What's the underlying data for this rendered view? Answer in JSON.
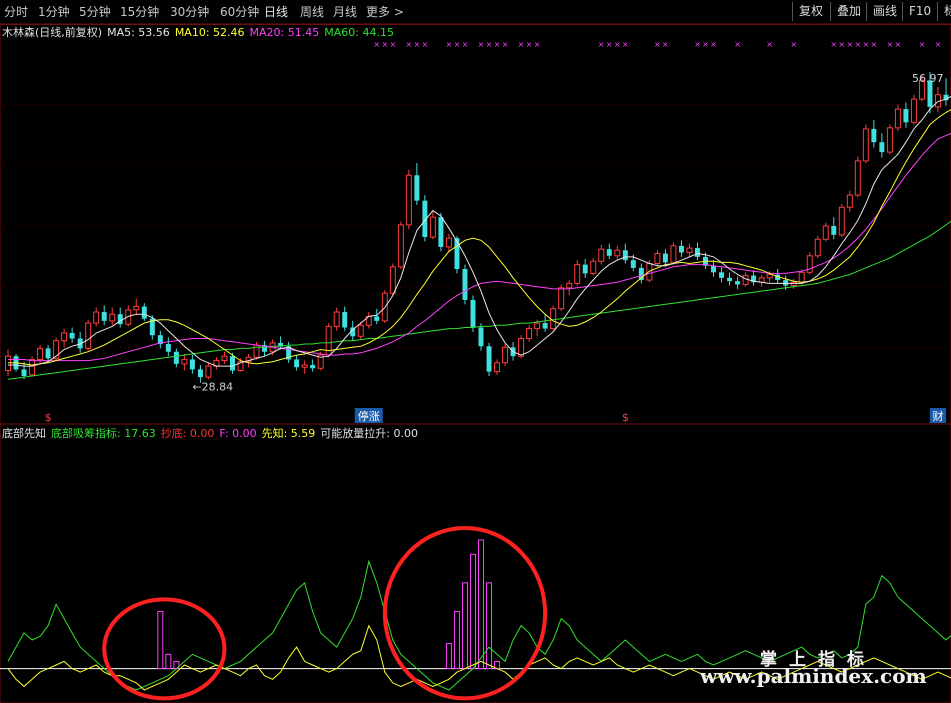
{
  "toolbar": {
    "periods": [
      "分时",
      "1分钟",
      "5分钟",
      "15分钟",
      "30分钟",
      "60分钟",
      "日线",
      "周线",
      "月线",
      "更多 >"
    ],
    "active_period": "日线",
    "buttons": [
      "复权",
      "叠加",
      "画线",
      "F10",
      "标"
    ]
  },
  "main_legend": {
    "name": "木林森(日线,前复权)",
    "ma5": "MA5: 53.56",
    "ma10": "MA10: 52.46",
    "ma20": "MA20: 51.45",
    "ma60": "MA60: 44.15"
  },
  "indicator_legend": {
    "name": "底部先知",
    "d1": "底部吸筹指标: 17.63",
    "d2": "抄底: 0.00",
    "d3": "F: 0.00",
    "d4": "先知: 5.59",
    "d5": "可能放量拉升: 0.00"
  },
  "colors": {
    "up": "#ff3c3c",
    "down": "#40e0e0",
    "ma5": "#e8e8e8",
    "ma10": "#ffff30",
    "ma20": "#ff40ff",
    "ma60": "#30e030",
    "bars": "#ff40ff",
    "ind_yellow": "#ffff30",
    "ind_green": "#30e030",
    "circle": "#ff2020"
  },
  "chart_data": {
    "type": "candlestick",
    "y_range": [
      26.5,
      59.5
    ],
    "price_max_label": "56.97",
    "price_min_label": "28.84",
    "candles": [
      [
        29.9,
        31.8,
        29.4,
        31.2
      ],
      [
        31.2,
        31.4,
        29.8,
        30.0
      ],
      [
        30.0,
        30.7,
        29.1,
        29.4
      ],
      [
        29.5,
        31.2,
        29.4,
        30.9
      ],
      [
        30.9,
        32.2,
        30.5,
        31.9
      ],
      [
        31.9,
        32.2,
        30.6,
        31.0
      ],
      [
        31.0,
        32.9,
        30.8,
        32.6
      ],
      [
        32.6,
        33.7,
        32.0,
        33.3
      ],
      [
        33.3,
        33.8,
        32.4,
        32.8
      ],
      [
        32.8,
        33.4,
        31.5,
        31.9
      ],
      [
        31.9,
        34.5,
        31.7,
        34.2
      ],
      [
        34.2,
        35.6,
        33.9,
        35.2
      ],
      [
        35.2,
        35.8,
        34.0,
        34.4
      ],
      [
        34.4,
        35.6,
        34.0,
        35.0
      ],
      [
        35.0,
        35.6,
        33.8,
        34.1
      ],
      [
        34.1,
        35.8,
        33.9,
        35.4
      ],
      [
        35.4,
        36.4,
        34.9,
        35.7
      ],
      [
        35.7,
        36.0,
        34.4,
        34.6
      ],
      [
        34.6,
        34.9,
        32.7,
        33.1
      ],
      [
        33.1,
        33.5,
        31.9,
        32.3
      ],
      [
        32.3,
        32.9,
        31.2,
        31.6
      ],
      [
        31.6,
        31.9,
        30.2,
        30.5
      ],
      [
        30.5,
        31.4,
        29.9,
        30.9
      ],
      [
        30.9,
        31.3,
        29.6,
        30.0
      ],
      [
        30.0,
        30.4,
        28.8,
        29.3
      ],
      [
        29.3,
        30.6,
        29.1,
        30.3
      ],
      [
        30.3,
        31.1,
        30.0,
        30.8
      ],
      [
        30.8,
        31.6,
        30.5,
        31.2
      ],
      [
        31.2,
        31.5,
        29.6,
        29.9
      ],
      [
        29.9,
        31.0,
        29.8,
        30.7
      ],
      [
        30.7,
        31.4,
        30.2,
        31.1
      ],
      [
        31.1,
        32.5,
        30.9,
        32.2
      ],
      [
        32.2,
        32.6,
        31.2,
        31.6
      ],
      [
        31.6,
        32.7,
        31.3,
        32.4
      ],
      [
        32.4,
        33.0,
        31.8,
        32.1
      ],
      [
        32.1,
        32.5,
        30.6,
        30.9
      ],
      [
        30.9,
        31.3,
        29.9,
        30.2
      ],
      [
        30.2,
        30.8,
        29.6,
        30.4
      ],
      [
        30.4,
        30.9,
        29.8,
        30.1
      ],
      [
        30.1,
        31.6,
        29.9,
        31.3
      ],
      [
        31.3,
        34.2,
        31.1,
        33.9
      ],
      [
        33.9,
        35.6,
        33.5,
        35.2
      ],
      [
        35.2,
        35.7,
        33.5,
        33.8
      ],
      [
        33.8,
        34.4,
        32.6,
        33.0
      ],
      [
        33.0,
        34.3,
        32.7,
        34.0
      ],
      [
        34.0,
        35.2,
        33.7,
        34.8
      ],
      [
        34.8,
        35.5,
        34.1,
        34.4
      ],
      [
        34.4,
        37.2,
        34.2,
        36.9
      ],
      [
        36.9,
        39.6,
        36.7,
        39.3
      ],
      [
        39.3,
        43.4,
        39.1,
        43.1
      ],
      [
        43.1,
        48.1,
        42.7,
        47.6
      ],
      [
        47.6,
        48.7,
        44.9,
        45.3
      ],
      [
        45.3,
        45.8,
        41.6,
        42.0
      ],
      [
        42.0,
        44.3,
        41.8,
        43.8
      ],
      [
        43.8,
        44.2,
        40.7,
        41.1
      ],
      [
        41.1,
        42.3,
        40.6,
        41.9
      ],
      [
        41.9,
        42.1,
        38.7,
        39.1
      ],
      [
        39.1,
        39.5,
        35.9,
        36.3
      ],
      [
        36.3,
        36.7,
        33.4,
        33.8
      ],
      [
        33.8,
        34.2,
        31.7,
        32.1
      ],
      [
        32.1,
        32.4,
        29.4,
        29.8
      ],
      [
        29.8,
        30.9,
        29.5,
        30.6
      ],
      [
        30.6,
        32.3,
        30.3,
        32.0
      ],
      [
        32.0,
        32.5,
        30.8,
        31.2
      ],
      [
        31.2,
        33.1,
        31.0,
        32.8
      ],
      [
        32.8,
        34.0,
        32.5,
        33.7
      ],
      [
        33.7,
        34.5,
        33.0,
        34.2
      ],
      [
        34.2,
        35.0,
        33.4,
        33.7
      ],
      [
        33.7,
        35.8,
        33.5,
        35.5
      ],
      [
        35.5,
        37.7,
        35.3,
        37.4
      ],
      [
        37.4,
        38.1,
        36.7,
        37.8
      ],
      [
        37.8,
        39.9,
        37.6,
        39.5
      ],
      [
        39.5,
        40.0,
        38.3,
        38.7
      ],
      [
        38.7,
        40.1,
        38.5,
        39.8
      ],
      [
        39.8,
        41.3,
        39.5,
        40.9
      ],
      [
        40.9,
        41.4,
        40.0,
        40.3
      ],
      [
        40.3,
        41.2,
        39.9,
        40.8
      ],
      [
        40.8,
        41.4,
        39.6,
        39.9
      ],
      [
        39.9,
        40.4,
        38.9,
        39.2
      ],
      [
        39.2,
        39.6,
        37.8,
        38.1
      ],
      [
        38.1,
        39.9,
        37.9,
        39.6
      ],
      [
        39.6,
        40.8,
        39.3,
        40.5
      ],
      [
        40.5,
        40.9,
        39.3,
        39.7
      ],
      [
        39.7,
        41.5,
        39.5,
        41.2
      ],
      [
        41.2,
        41.7,
        40.2,
        40.6
      ],
      [
        40.6,
        41.4,
        40.2,
        41.0
      ],
      [
        41.0,
        41.5,
        39.9,
        40.2
      ],
      [
        40.2,
        40.6,
        39.1,
        39.4
      ],
      [
        39.4,
        39.9,
        38.4,
        38.8
      ],
      [
        38.8,
        39.3,
        37.9,
        38.3
      ],
      [
        38.3,
        38.8,
        37.6,
        38.0
      ],
      [
        38.0,
        38.4,
        37.3,
        37.7
      ],
      [
        37.7,
        38.8,
        37.5,
        38.5
      ],
      [
        38.5,
        39.0,
        37.6,
        37.9
      ],
      [
        37.9,
        38.6,
        37.5,
        38.3
      ],
      [
        38.3,
        38.9,
        37.9,
        38.6
      ],
      [
        38.6,
        39.1,
        37.8,
        38.1
      ],
      [
        38.1,
        38.5,
        37.2,
        37.6
      ],
      [
        37.6,
        38.2,
        37.3,
        37.9
      ],
      [
        37.9,
        39.1,
        37.7,
        38.8
      ],
      [
        38.8,
        40.6,
        38.6,
        40.3
      ],
      [
        40.3,
        42.1,
        40.1,
        41.8
      ],
      [
        41.8,
        43.3,
        41.6,
        43.0
      ],
      [
        43.0,
        43.8,
        41.8,
        42.2
      ],
      [
        42.2,
        45.0,
        42.0,
        44.7
      ],
      [
        44.7,
        46.2,
        44.3,
        45.8
      ],
      [
        45.8,
        49.3,
        45.6,
        48.9
      ],
      [
        48.9,
        52.2,
        48.7,
        51.8
      ],
      [
        51.8,
        52.6,
        50.1,
        50.6
      ],
      [
        50.6,
        51.4,
        49.2,
        49.7
      ],
      [
        49.7,
        52.2,
        49.5,
        51.9
      ],
      [
        51.9,
        54.0,
        51.6,
        53.6
      ],
      [
        53.6,
        54.2,
        51.9,
        52.4
      ],
      [
        52.4,
        54.9,
        52.2,
        54.5
      ],
      [
        54.5,
        56.7,
        54.3,
        56.2
      ],
      [
        56.2,
        56.97,
        53.2,
        53.8
      ],
      [
        53.8,
        55.6,
        53.3,
        54.9
      ],
      [
        54.9,
        56.4,
        53.9,
        54.4
      ]
    ],
    "ma5": [
      30.4,
      30.4,
      30.3,
      30.3,
      30.5,
      30.7,
      31.2,
      31.8,
      32.1,
      32.3,
      32.7,
      33.3,
      33.6,
      33.9,
      34.4,
      34.8,
      35.0,
      35.0,
      34.7,
      34.2,
      33.5,
      32.8,
      32.1,
      31.5,
      30.9,
      30.6,
      30.3,
      30.3,
      30.3,
      30.6,
      30.8,
      31.0,
      31.2,
      31.5,
      31.9,
      32.0,
      31.7,
      31.5,
      31.3,
      31.1,
      31.2,
      31.9,
      32.8,
      33.6,
      34.2,
      34.8,
      34.9,
      35.6,
      36.7,
      38.3,
      40.6,
      42.6,
      43.5,
      44.4,
      43.9,
      42.8,
      41.6,
      40.3,
      38.8,
      37.1,
      35.1,
      33.6,
      32.4,
      31.6,
      31.3,
      31.6,
      32.2,
      32.8,
      33.4,
      34.3,
      35.3,
      36.4,
      37.3,
      38.1,
      38.9,
      39.5,
      39.9,
      40.2,
      40.2,
      39.9,
      39.6,
      39.4,
      39.4,
      39.6,
      39.9,
      40.2,
      40.5,
      40.4,
      40.2,
      39.7,
      39.1,
      38.6,
      38.2,
      38.0,
      37.9,
      37.8,
      37.8,
      37.8,
      37.8,
      37.8,
      38.0,
      38.5,
      39.3,
      40.3,
      41.4,
      42.4,
      43.5,
      45.0,
      46.8,
      48.1,
      48.8,
      49.5,
      50.6,
      51.8,
      52.6,
      53.6,
      54.3,
      54.5,
      54.9
    ],
    "ma10": [
      30.6,
      30.6,
      30.5,
      30.4,
      30.5,
      30.6,
      30.8,
      31.0,
      31.2,
      31.4,
      31.6,
      31.9,
      32.2,
      32.6,
      33.0,
      33.4,
      33.8,
      34.2,
      34.4,
      34.5,
      34.5,
      34.3,
      34.0,
      33.6,
      33.2,
      32.8,
      32.3,
      31.8,
      31.3,
      30.8,
      30.6,
      30.5,
      30.6,
      30.7,
      30.9,
      31.1,
      31.3,
      31.4,
      31.6,
      31.8,
      31.7,
      31.8,
      31.9,
      32.0,
      32.1,
      32.4,
      32.8,
      33.3,
      33.9,
      34.7,
      35.7,
      36.8,
      37.8,
      38.9,
      39.8,
      40.7,
      41.2,
      41.7,
      41.9,
      41.7,
      41.1,
      40.2,
      39.3,
      38.3,
      37.4,
      36.5,
      35.7,
      35.0,
      34.4,
      34.1,
      33.9,
      34.0,
      34.3,
      34.7,
      35.2,
      35.8,
      36.4,
      37.1,
      37.7,
      38.3,
      38.9,
      39.2,
      39.5,
      39.6,
      39.7,
      39.6,
      39.7,
      39.8,
      39.8,
      39.7,
      39.7,
      39.6,
      39.4,
      39.2,
      39.0,
      38.7,
      38.4,
      38.2,
      38.0,
      37.9,
      38.0,
      38.2,
      38.5,
      39.0,
      39.6,
      40.2,
      41.1,
      42.1,
      43.3,
      44.8,
      46.1,
      47.5,
      48.8,
      50.0,
      51.1,
      52.2,
      52.8,
      53.3,
      53.7
    ],
    "ma20": [
      30.9,
      30.9,
      30.9,
      30.8,
      30.8,
      30.8,
      30.8,
      30.8,
      30.8,
      30.8,
      30.8,
      30.9,
      31.0,
      31.2,
      31.4,
      31.6,
      31.8,
      32.0,
      32.2,
      32.4,
      32.5,
      32.6,
      32.7,
      32.8,
      32.8,
      32.8,
      32.7,
      32.6,
      32.5,
      32.4,
      32.3,
      32.2,
      32.1,
      32.0,
      31.9,
      31.8,
      31.7,
      31.6,
      31.5,
      31.4,
      31.3,
      31.3,
      31.4,
      31.4,
      31.5,
      31.7,
      31.9,
      32.2,
      32.5,
      32.9,
      33.3,
      33.9,
      34.4,
      35.0,
      35.6,
      36.2,
      36.7,
      37.1,
      37.5,
      37.8,
      37.9,
      38.0,
      37.9,
      37.8,
      37.7,
      37.6,
      37.5,
      37.4,
      37.3,
      37.3,
      37.3,
      37.4,
      37.5,
      37.6,
      37.7,
      37.8,
      37.9,
      38.1,
      38.3,
      38.5,
      38.7,
      38.9,
      39.1,
      39.3,
      39.4,
      39.5,
      39.5,
      39.5,
      39.4,
      39.3,
      39.2,
      39.1,
      39.0,
      38.9,
      38.8,
      38.7,
      38.7,
      38.7,
      38.8,
      38.9,
      39.1,
      39.4,
      39.7,
      40.1,
      40.6,
      41.2,
      41.9,
      42.7,
      43.6,
      44.6,
      45.6,
      46.6,
      47.6,
      48.5,
      49.4,
      50.2,
      50.9,
      51.2,
      51.5
    ],
    "ma60": [
      29.1,
      29.2,
      29.3,
      29.4,
      29.5,
      29.6,
      29.7,
      29.8,
      29.9,
      30.0,
      30.1,
      30.2,
      30.3,
      30.4,
      30.5,
      30.6,
      30.7,
      30.8,
      30.9,
      31.0,
      31.1,
      31.2,
      31.3,
      31.4,
      31.5,
      31.6,
      31.7,
      31.8,
      31.8,
      31.9,
      31.9,
      32.0,
      32.0,
      32.1,
      32.1,
      32.2,
      32.2,
      32.3,
      32.3,
      32.4,
      32.4,
      32.5,
      32.6,
      32.6,
      32.7,
      32.8,
      32.8,
      32.9,
      33.0,
      33.1,
      33.2,
      33.3,
      33.4,
      33.5,
      33.6,
      33.7,
      33.7,
      33.8,
      33.8,
      33.9,
      33.9,
      34.0,
      34.0,
      34.1,
      34.2,
      34.2,
      34.3,
      34.4,
      34.5,
      34.6,
      34.7,
      34.8,
      34.9,
      35.0,
      35.1,
      35.2,
      35.3,
      35.4,
      35.5,
      35.6,
      35.7,
      35.8,
      35.9,
      36.0,
      36.1,
      36.2,
      36.3,
      36.4,
      36.5,
      36.6,
      36.7,
      36.8,
      36.9,
      37.0,
      37.1,
      37.2,
      37.3,
      37.4,
      37.5,
      37.6,
      37.7,
      37.8,
      38.0,
      38.2,
      38.4,
      38.6,
      38.9,
      39.2,
      39.5,
      39.8,
      40.1,
      40.5,
      40.9,
      41.3,
      41.7,
      42.1,
      42.6,
      43.1,
      43.6
    ],
    "markers": [
      {
        "index": 5,
        "label": "$"
      },
      {
        "index": 45,
        "label": "停涨"
      },
      {
        "index": 77,
        "label": "$"
      },
      {
        "index": 116,
        "label": "财"
      }
    ],
    "x_marks_indices": [
      46,
      47,
      48,
      50,
      51,
      52,
      55,
      56,
      57,
      59,
      60,
      61,
      62,
      64,
      65,
      66,
      74,
      75,
      76,
      77,
      81,
      82,
      86,
      87,
      88,
      91,
      95,
      98,
      103,
      104,
      105,
      106,
      107,
      108,
      110,
      111,
      114,
      116
    ],
    "indicator": {
      "y_range": [
        -6,
        50
      ],
      "bars": [
        [
          19,
          16
        ],
        [
          20,
          4
        ],
        [
          21,
          2
        ],
        [
          55,
          7
        ],
        [
          56,
          16
        ],
        [
          57,
          24
        ],
        [
          58,
          32
        ],
        [
          59,
          36
        ],
        [
          60,
          24
        ],
        [
          61,
          2
        ]
      ],
      "yellow": [
        0,
        -3,
        -5,
        -3,
        -1,
        0,
        1,
        2,
        0,
        -1,
        0,
        1,
        -1,
        -2,
        -2,
        -3,
        -4,
        -6,
        -5,
        -4,
        -3,
        -1,
        1,
        0,
        -1,
        0,
        1,
        0,
        -1,
        -2,
        0,
        1,
        -2,
        -3,
        -1,
        3,
        6,
        2,
        1,
        0,
        -1,
        0,
        2,
        4,
        5,
        12,
        8,
        -1,
        -4,
        -5,
        -4,
        -3,
        -4,
        -5,
        -4,
        -3,
        -1,
        0,
        1,
        2,
        1,
        0,
        -1,
        -3,
        -1,
        1,
        2,
        3,
        1,
        0,
        2,
        3,
        2,
        1,
        2,
        3,
        1,
        0,
        -1,
        0,
        1,
        0,
        -1,
        -2,
        -1,
        0,
        -1,
        -2,
        -3,
        -2,
        -1,
        -2,
        -3,
        -2,
        -1,
        -2,
        -3,
        -2,
        -1,
        0,
        1,
        2,
        1,
        0,
        -1,
        0,
        1,
        2,
        3,
        2,
        1,
        0,
        -1,
        -2,
        -3,
        -2,
        -1,
        -2,
        -3
      ],
      "green": [
        2,
        6,
        10,
        8,
        9,
        12,
        18,
        14,
        10,
        6,
        4,
        2,
        0,
        -2,
        -4,
        -5,
        -6,
        -5,
        -4,
        -3,
        -2,
        0,
        2,
        4,
        3,
        2,
        1,
        0,
        1,
        2,
        4,
        6,
        8,
        10,
        14,
        18,
        22,
        24,
        16,
        10,
        8,
        6,
        10,
        14,
        20,
        30,
        24,
        16,
        8,
        4,
        2,
        0,
        -2,
        -4,
        -5,
        -6,
        -4,
        -2,
        0,
        3,
        6,
        4,
        2,
        8,
        12,
        10,
        6,
        4,
        8,
        14,
        12,
        8,
        6,
        4,
        2,
        4,
        6,
        8,
        6,
        4,
        2,
        3,
        4,
        3,
        2,
        3,
        4,
        2,
        1,
        2,
        3,
        4,
        5,
        4,
        3,
        2,
        3,
        4,
        5,
        6,
        4,
        3,
        4,
        5,
        3,
        4,
        6,
        18,
        20,
        26,
        24,
        20,
        18,
        16,
        14,
        12,
        10,
        8,
        10
      ]
    }
  },
  "watermark": {
    "cn": "掌上指标",
    "url": "www.palmindex.com"
  }
}
